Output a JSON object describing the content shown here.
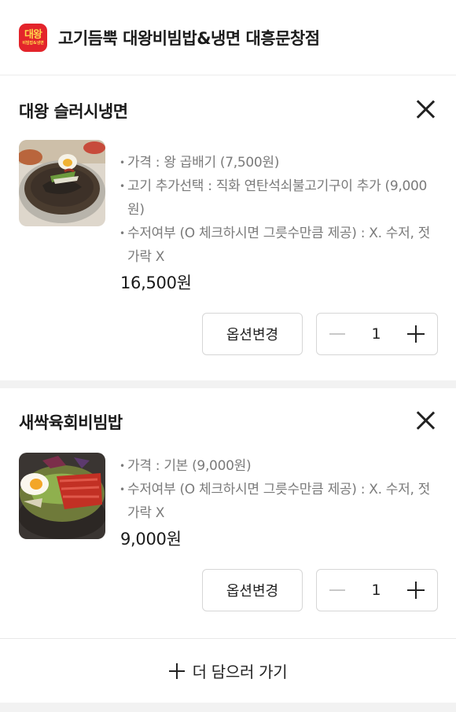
{
  "header": {
    "store_name": "고기듬뿍 대왕비빔밥&냉면 대흥문창점",
    "logo_text": "대왕",
    "logo_subtext": "비빔밥&냉면"
  },
  "items": [
    {
      "name": "대왕 슬러시냉면",
      "options": [
        "가격 : 왕 곱배기 (7,500원)",
        "고기 추가선택 : 직화 연탄석쇠불고기구이 추가 (9,000원)",
        "수저여부 (O 체크하시면 그릇수만큼 제공) : X. 수저, 젓가락 X"
      ],
      "price": "16,500원",
      "change_option_label": "옵션변경",
      "quantity": "1"
    },
    {
      "name": "새싹육회비빔밥",
      "options": [
        "가격 : 기본 (9,000원)",
        "수저여부 (O 체크하시면 그릇수만큼 제공) : X. 수저, 젓가락 X"
      ],
      "price": "9,000원",
      "change_option_label": "옵션변경",
      "quantity": "1"
    }
  ],
  "add_more_label": "더 담으러 가기",
  "colors": {
    "brand": "#e3242b",
    "logo_text": "#ffd84d",
    "option_text": "#7a7a7a",
    "separator": "#f2f2f2"
  },
  "icons": {
    "close": "close-icon",
    "minus": "minus-icon",
    "plus": "plus-icon"
  }
}
